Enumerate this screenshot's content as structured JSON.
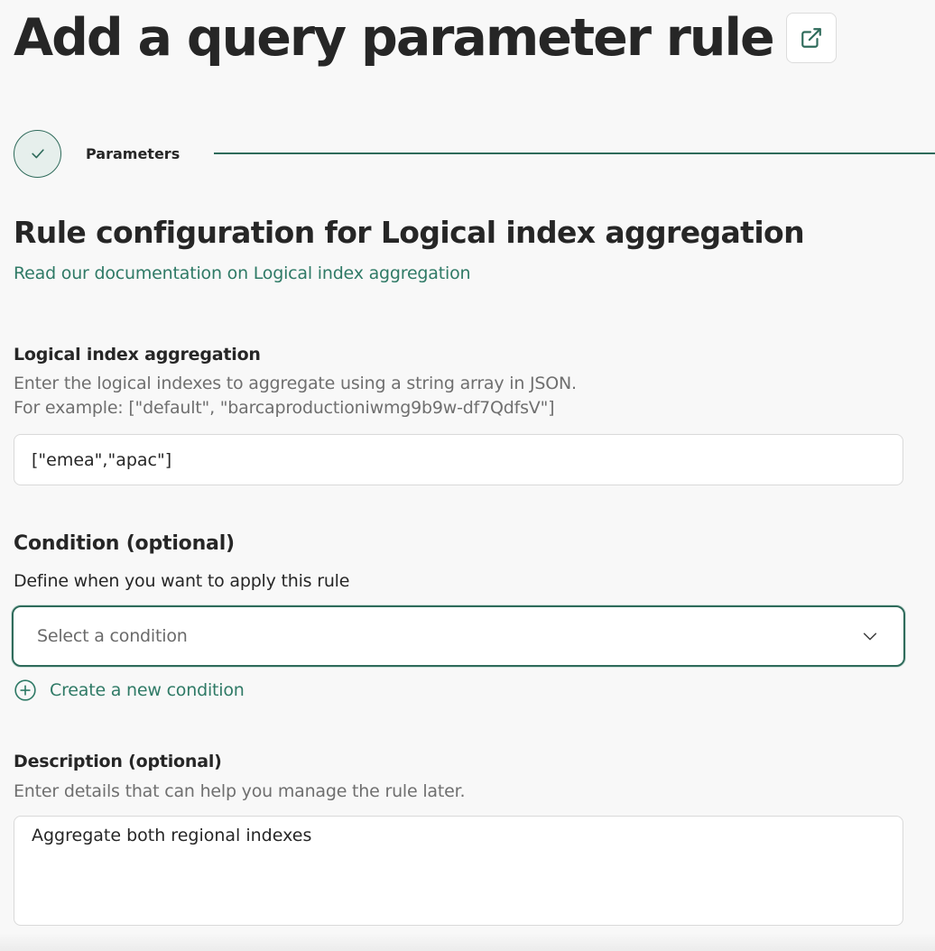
{
  "header": {
    "title": "Add a query parameter rule",
    "external_link_icon": "external-link-icon"
  },
  "stepper": {
    "steps": [
      {
        "label": "Parameters",
        "status": "completed",
        "icon": "check-icon"
      }
    ]
  },
  "section": {
    "title": "Rule configuration for Logical index aggregation",
    "doc_link": "Read our documentation on Logical index aggregation"
  },
  "aggregation": {
    "label": "Logical index aggregation",
    "help_line1": "Enter the logical indexes to aggregate using a string array in JSON.",
    "help_line2": "For example: [\"default\", \"barcaproductioniwmg9b9w-df7QdfsV\"]",
    "value": "[\"emea\",\"apac\"]"
  },
  "condition": {
    "title": "Condition (optional)",
    "help": "Define when you want to apply this rule",
    "placeholder": "Select a condition",
    "dropdown_icon": "chevron-down-icon",
    "create_label": "Create a new condition",
    "create_icon": "plus-circle-icon"
  },
  "description": {
    "label": "Description (optional)",
    "help": "Enter details that can help you manage the rule later.",
    "value": "Aggregate both regional indexes"
  },
  "colors": {
    "accent": "#2f6b5b",
    "link": "#2f7a66",
    "text": "#262626",
    "muted": "#6f6f6f",
    "background": "#f8f8f8"
  }
}
